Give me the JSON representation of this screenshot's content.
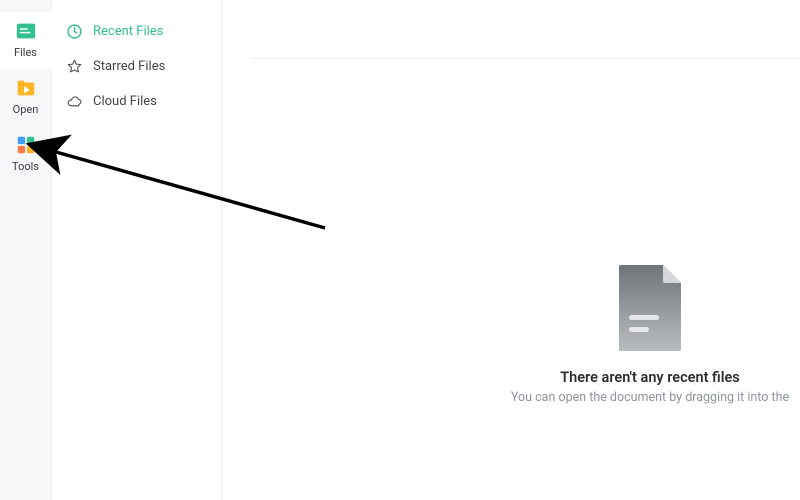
{
  "primary_sidebar": {
    "items": [
      {
        "label": "Files",
        "active": true
      },
      {
        "label": "Open",
        "active": false
      },
      {
        "label": "Tools",
        "active": false
      }
    ]
  },
  "secondary_sidebar": {
    "items": [
      {
        "label": "Recent Files",
        "active": true
      },
      {
        "label": "Starred Files",
        "active": false
      },
      {
        "label": "Cloud Files",
        "active": false
      }
    ]
  },
  "empty_state": {
    "title": "There aren't any recent files",
    "subtitle": "You can open the document by dragging it into the"
  },
  "colors": {
    "accent_green": "#2fbf8f",
    "folder_yellow": "#ffb427"
  }
}
